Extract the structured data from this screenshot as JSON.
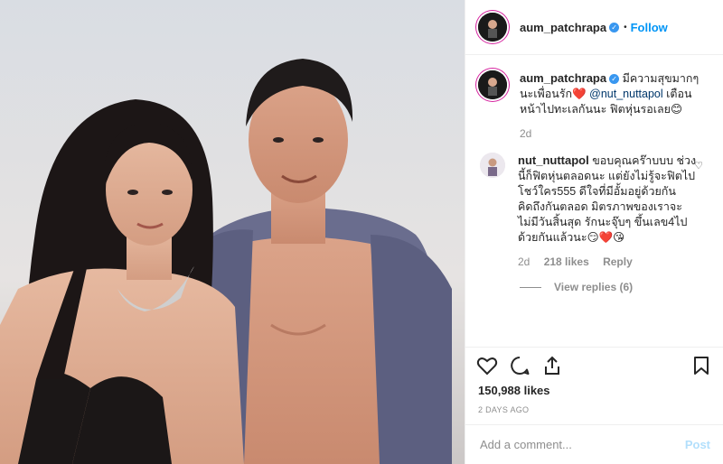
{
  "post": {
    "author": "aum_patchrapa",
    "follow_label": "Follow",
    "separator": "•"
  },
  "caption": {
    "author": "aum_patchrapa",
    "text_before": "มีความสุขมากๆนะเพื่อนรัก❤️ ",
    "mention": "@nut_nuttapol",
    "text_after": " เตือนหน้าไปทะเลกันนะ ฟิตหุ่นรอเลย😊",
    "time": "2d"
  },
  "reply": {
    "author": "nut_nuttapol",
    "text": "ขอบคุณคร๊าบบบ ช่วงนี้ก็ฟิตหุ่นตลอดนะ แต่ยังไม่รู้จะฟิตไปโชว์ใคร555 ดีใจที่มีอั้มอยู่ด้วยกัน คิดถึงกันตลอด มิตรภาพของเราจะไม่มีวันสิ้นสุด รักนะจุ๊บๆ ขึ้นเลข4ไปด้วยกันแล้วนะ😏❤️😘",
    "time": "2d",
    "likes": "218 likes",
    "reply_label": "Reply",
    "view_replies": "View replies (6)"
  },
  "stats": {
    "likes": "150,988 likes",
    "time_ago": "2 DAYS AGO"
  },
  "composer": {
    "placeholder": "Add a comment...",
    "post_label": "Post"
  },
  "colors": {
    "accent": "#0095f6",
    "muted": "#8e8e8e",
    "border": "#efefef"
  }
}
